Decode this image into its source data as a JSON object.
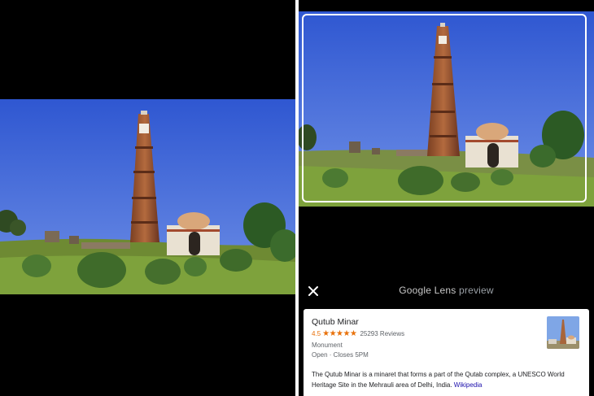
{
  "lens": {
    "brand": "Google Lens",
    "mode": "preview",
    "close_icon": "close-icon"
  },
  "result": {
    "name": "Qutub Minar",
    "rating": "4.5",
    "stars": "★★★★★",
    "reviews": "25293 Reviews",
    "category": "Monument",
    "hours": "Open · Closes 5PM",
    "description": "The Qutub Minar is a minaret that forms a part of the Qutab complex, a UNESCO World Heritage Site in the Mehrauli area of Delhi, India.",
    "link_label": "Wikipedia"
  },
  "colors": {
    "accent_star": "#e8710a",
    "link": "#1a0dab",
    "sky": "#3d63d6"
  }
}
